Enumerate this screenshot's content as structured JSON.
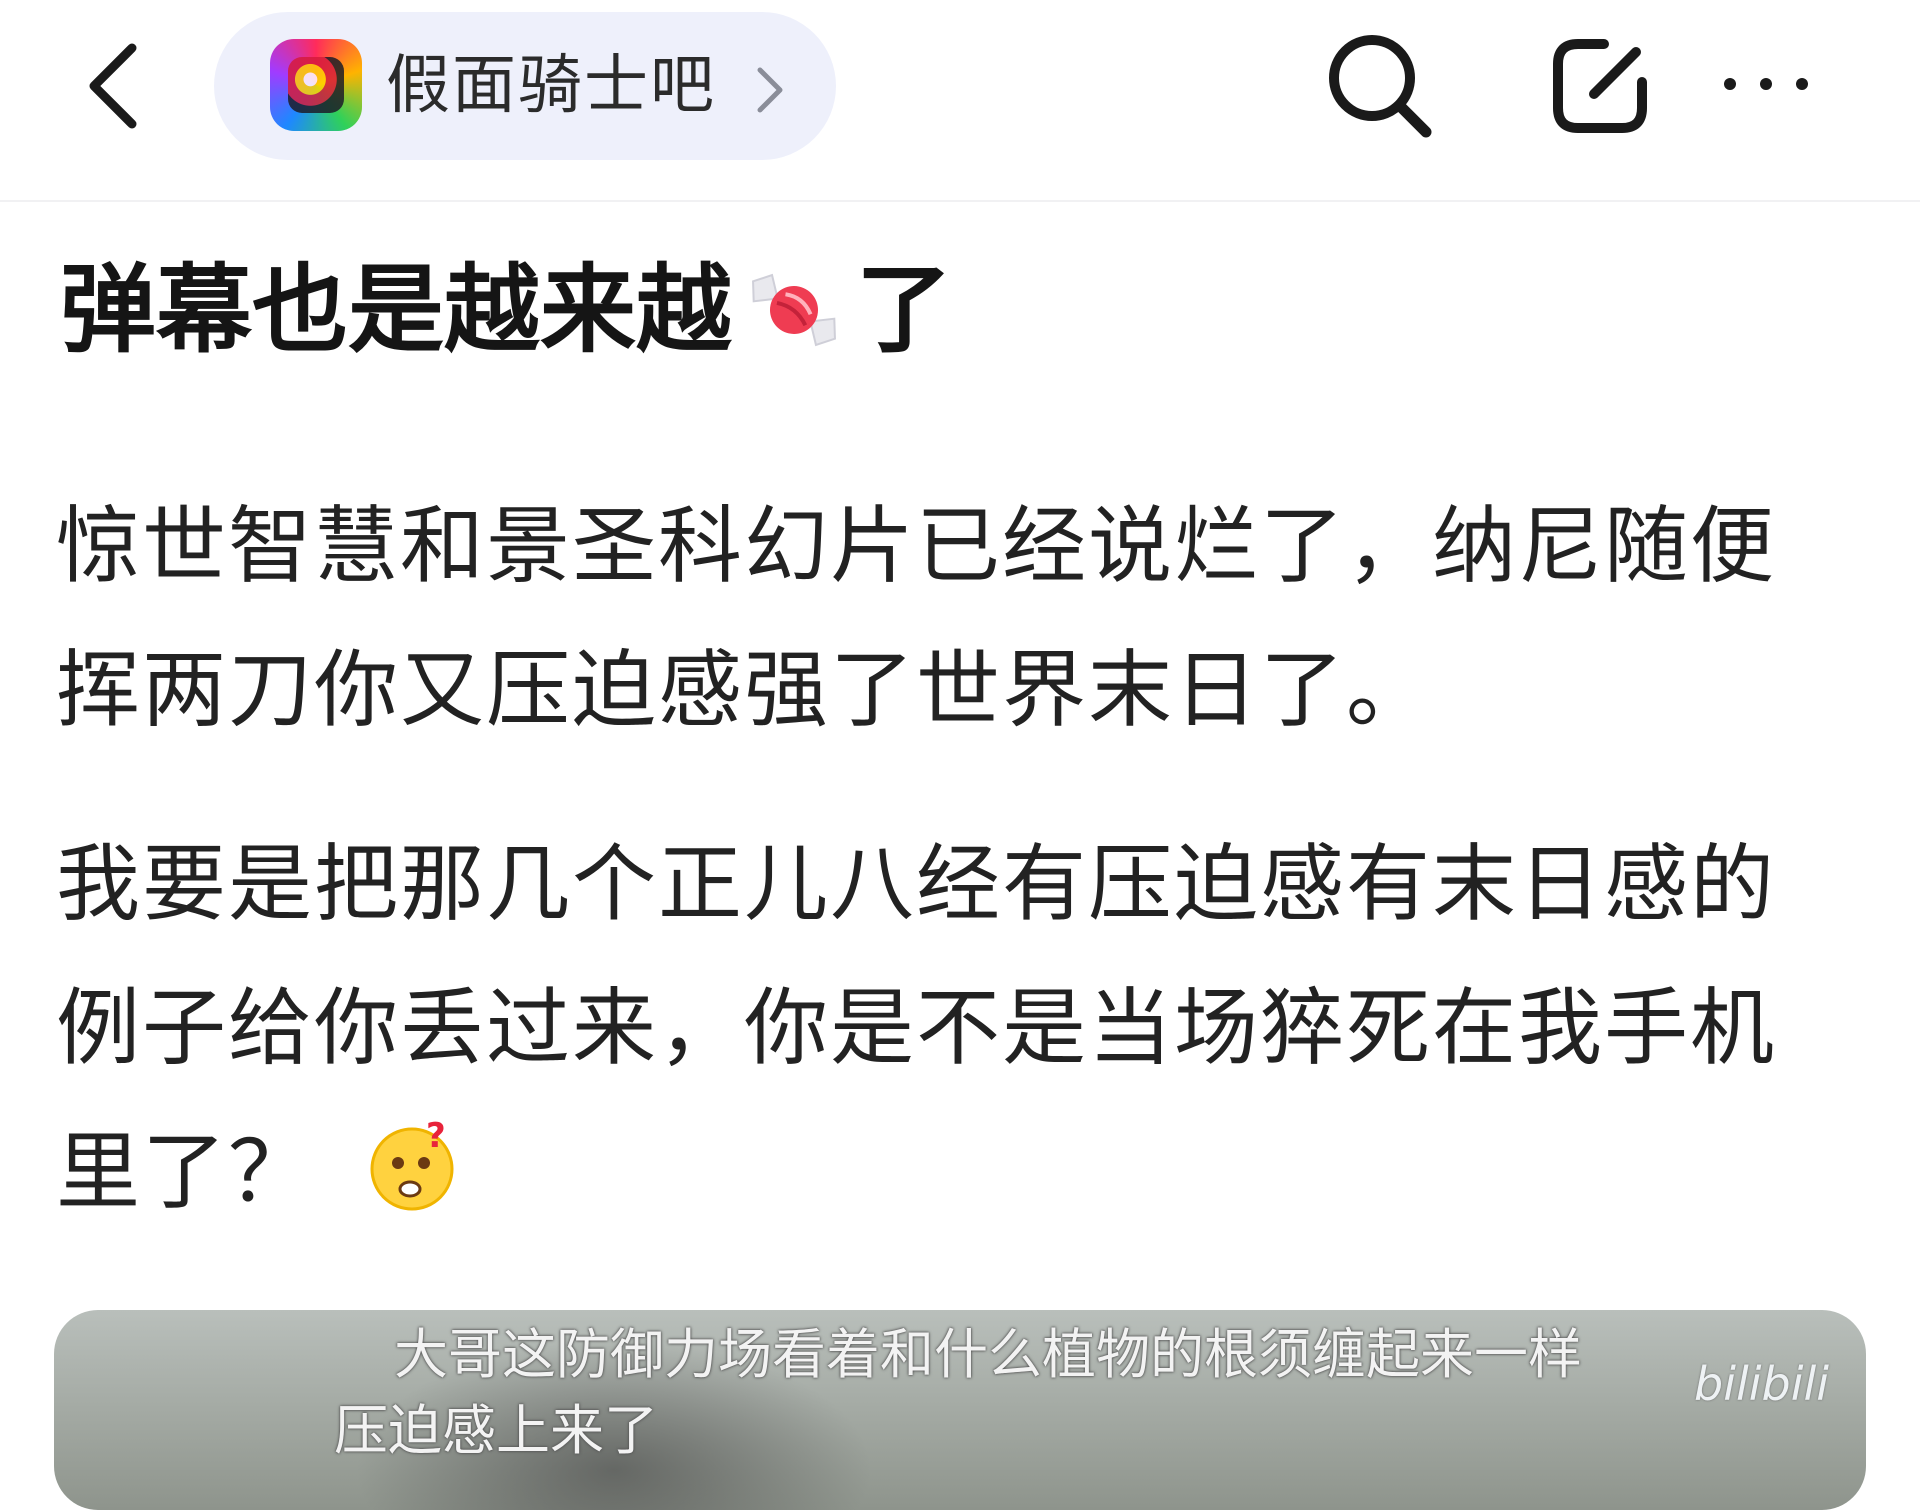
{
  "header": {
    "back_icon": "chevron-left-icon",
    "forum": {
      "name": "假面骑士吧",
      "avatar_icon": "forum-avatar-icon",
      "chevron_icon": "chevron-right-icon"
    },
    "actions": {
      "search_icon": "search-icon",
      "edit_icon": "edit-icon",
      "more_icon": "more-dots-icon"
    }
  },
  "post": {
    "title_before": "弹幕也是越来越",
    "title_icon": "candy-icon",
    "title_after": "了",
    "paragraphs": [
      "惊世智慧和景圣科幻片已经说烂了，纳尼随便挥两刀你又压迫感强了世界末日了。",
      "我要是把那几个正儿八经有压迫感有末日感的例子给你丢过来，你是不是当场猝死在我手机里了？"
    ],
    "emoji_icon": "confused-face-emoji-icon"
  },
  "media": {
    "danmaku": [
      "大哥这防御力场看着和什么植物的根须缠起来一样",
      "压迫感上来了"
    ],
    "watermark": "bilibili"
  },
  "colors": {
    "pill_bg": "#eef0fb",
    "text": "#1f1f1f",
    "icon": "#1a1a1a"
  }
}
